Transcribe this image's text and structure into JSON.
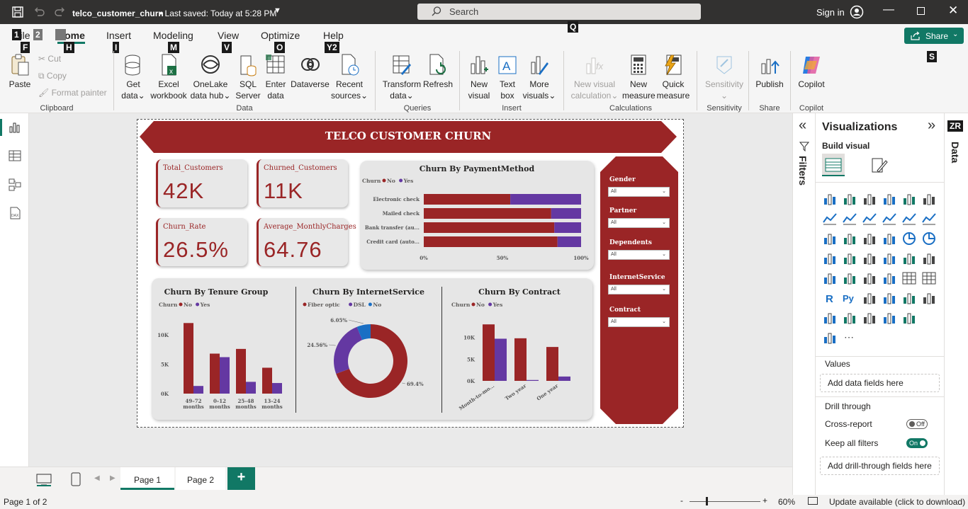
{
  "titlebar": {
    "file_name": "telco_customer_churn",
    "saved_text": "• Last saved: Today at 5:28 PM",
    "search_placeholder": "Search",
    "signin": "Sign in"
  },
  "keytips": {
    "file": "1",
    "file2": "F",
    "num2": "2",
    "home": "H",
    "insert": "I",
    "modeling": "M",
    "view": "V",
    "optimize": "O",
    "help": "Y2",
    "search": "Q",
    "share": "S",
    "data": "ZR"
  },
  "tabs": {
    "file": "File",
    "home": "Home",
    "insert": "Insert",
    "modeling": "Modeling",
    "view": "View",
    "optimize": "Optimize",
    "help": "Help"
  },
  "share_label": "Share",
  "ribbon": {
    "clipboard": {
      "paste": "Paste",
      "cut": "Cut",
      "copy": "Copy",
      "format_painter": "Format painter",
      "label": "Clipboard"
    },
    "data": {
      "get_data": [
        "Get",
        "data"
      ],
      "excel": [
        "Excel",
        "workbook"
      ],
      "onelake": [
        "OneLake",
        "data hub"
      ],
      "sql": [
        "SQL",
        "Server"
      ],
      "enter": [
        "Enter",
        "data"
      ],
      "dataverse": "Dataverse",
      "recent": [
        "Recent",
        "sources"
      ],
      "label": "Data"
    },
    "queries": {
      "transform": [
        "Transform",
        "data"
      ],
      "refresh": "Refresh",
      "label": "Queries"
    },
    "insert": {
      "new_visual": [
        "New",
        "visual"
      ],
      "text_box": [
        "Text",
        "box"
      ],
      "more_visuals": [
        "More",
        "visuals"
      ],
      "label": "Insert"
    },
    "calculations": {
      "new_visual_calc": [
        "New visual",
        "calculation"
      ],
      "new_measure": [
        "New",
        "measure"
      ],
      "quick_measure": [
        "Quick",
        "measure"
      ],
      "label": "Calculations"
    },
    "sensitivity": {
      "btn": "Sensitivity",
      "label": "Sensitivity"
    },
    "share": {
      "publish": "Publish",
      "label": "Share"
    },
    "copilot": {
      "btn": "Copilot",
      "label": "Copilot"
    }
  },
  "report": {
    "title": "TELCO CUSTOMER CHURN",
    "cards": [
      {
        "label": "Total_Customers",
        "value": "42K"
      },
      {
        "label": "Churned_Customers",
        "value": "11K"
      },
      {
        "label": "Churn_Rate",
        "value": "26.5%"
      },
      {
        "label": "Average_MonthlyCharges",
        "value": "64.76"
      }
    ],
    "slicers": [
      {
        "label": "Gender",
        "value": "All"
      },
      {
        "label": "Partner",
        "value": "All"
      },
      {
        "label": "Dependents",
        "value": "All"
      },
      {
        "label": "InternetService",
        "value": "All"
      },
      {
        "label": "Contract",
        "value": "All"
      }
    ]
  },
  "colors": {
    "no": "#9a2526",
    "yes": "#6438a2",
    "dsl": "#6438a2",
    "fiber": "#9a2526",
    "na": "#1a6fc4"
  },
  "chart_data": [
    {
      "type": "bar",
      "title": "Churn By PaymentMethod",
      "legend_title": "Churn",
      "legend": [
        "No",
        "Yes"
      ],
      "stacked_percent": true,
      "categories": [
        "Electronic check",
        "Mailed check",
        "Bank transfer (au...",
        "Credit card (auto..."
      ],
      "series": [
        {
          "name": "No",
          "values": [
            55,
            81,
            83,
            85
          ]
        },
        {
          "name": "Yes",
          "values": [
            45,
            19,
            17,
            15
          ]
        }
      ],
      "xticks": [
        "0%",
        "50%",
        "100%"
      ]
    },
    {
      "type": "bar",
      "title": "Churn By Tenure Group",
      "legend_title": "Churn",
      "legend": [
        "No",
        "Yes"
      ],
      "categories": [
        "49–72 months",
        "0–12 months",
        "25–48 months",
        "13–24 months"
      ],
      "series": [
        {
          "name": "No",
          "values": [
            12000,
            6800,
            7600,
            4400
          ]
        },
        {
          "name": "Yes",
          "values": [
            1300,
            6200,
            2000,
            1800
          ]
        }
      ],
      "yticks": [
        "0K",
        "5K",
        "10K"
      ],
      "ylim": [
        0,
        13000
      ]
    },
    {
      "type": "pie",
      "title": "Churn By InternetService",
      "legend": [
        "Fiber optic",
        "DSL",
        "No"
      ],
      "values": [
        69.4,
        24.56,
        6.05
      ],
      "labels": [
        "69.4%",
        "24.56%",
        "6.05%"
      ]
    },
    {
      "type": "bar",
      "title": "Churn By Contract",
      "legend_title": "Churn",
      "legend": [
        "No",
        "Yes"
      ],
      "categories": [
        "Month-to-mo...",
        "Two year",
        "One year"
      ],
      "series": [
        {
          "name": "No",
          "values": [
            13000,
            9800,
            7800
          ]
        },
        {
          "name": "Yes",
          "values": [
            9700,
            200,
            1000
          ]
        }
      ],
      "yticks": [
        "0K",
        "5K",
        "10K"
      ],
      "ylim": [
        0,
        14500
      ]
    }
  ],
  "pages": {
    "page1": "Page 1",
    "page2": "Page 2",
    "add": "+"
  },
  "filters_label": "Filters",
  "viz": {
    "title": "Visualizations",
    "build_visual": "Build visual",
    "values": "Values",
    "add_data": "Add data fields here",
    "drill": "Drill through",
    "cross_report": "Cross-report",
    "cross_state": "Off",
    "keep_filters": "Keep all filters",
    "keep_state": "On",
    "add_drill": "Add drill-through fields here"
  },
  "data_label": "Data",
  "status": {
    "page": "Page 1 of 2",
    "zoom": "60%",
    "update": "Update available (click to download)"
  }
}
